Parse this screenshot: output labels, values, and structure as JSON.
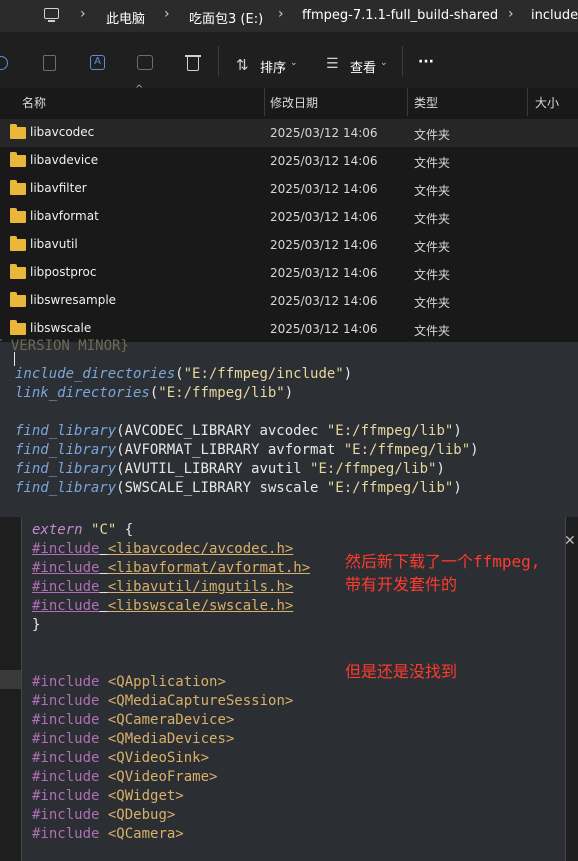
{
  "address_bar": {
    "crumbs": [
      "此电脑",
      "吃面包3 (E:)",
      "ffmpeg-7.1.1-full_build-shared",
      "include"
    ],
    "separator": "›"
  },
  "toolbar": {
    "sort_label": "排序",
    "view_label": "查看",
    "more_label": "···"
  },
  "columns": {
    "name": "名称",
    "modified": "修改日期",
    "type": "类型",
    "size": "大小"
  },
  "files": [
    {
      "name": "libavcodec",
      "date": "2025/03/12 14:06",
      "type": "文件夹"
    },
    {
      "name": "libavdevice",
      "date": "2025/03/12 14:06",
      "type": "文件夹"
    },
    {
      "name": "libavfilter",
      "date": "2025/03/12 14:06",
      "type": "文件夹"
    },
    {
      "name": "libavformat",
      "date": "2025/03/12 14:06",
      "type": "文件夹"
    },
    {
      "name": "libavutil",
      "date": "2025/03/12 14:06",
      "type": "文件夹"
    },
    {
      "name": "libpostproc",
      "date": "2025/03/12 14:06",
      "type": "文件夹"
    },
    {
      "name": "libswresample",
      "date": "2025/03/12 14:06",
      "type": "文件夹"
    },
    {
      "name": "libswscale",
      "date": "2025/03/12 14:06",
      "type": "文件夹"
    }
  ],
  "cmake_snippet": {
    "cut_line": "T VERSION MINOR}",
    "lines": [
      {
        "fn": "include_directories",
        "args": "(",
        "str": "\"E:/ffmpeg/include\"",
        "tail": ")"
      },
      {
        "fn": "link_directories",
        "args": "(",
        "str": "\"E:/ffmpeg/lib\"",
        "tail": ")"
      },
      {
        "fn": "",
        "args": "",
        "str": "",
        "tail": ""
      },
      {
        "fn": "find_library",
        "args": "(AVCODEC_LIBRARY avcodec ",
        "str": "\"E:/ffmpeg/lib\"",
        "tail": ")"
      },
      {
        "fn": "find_library",
        "args": "(AVFORMAT_LIBRARY avformat ",
        "str": "\"E:/ffmpeg/lib\"",
        "tail": ")"
      },
      {
        "fn": "find_library",
        "args": "(AVUTIL_LIBRARY avutil ",
        "str": "\"E:/ffmpeg/lib\"",
        "tail": ")"
      },
      {
        "fn": "find_library",
        "args": "(SWSCALE_LIBRARY swscale ",
        "str": "\"E:/ffmpeg/lib\"",
        "tail": ")"
      }
    ]
  },
  "cpp_snippet": {
    "extern_kw": "extern",
    "extern_str": "\"C\"",
    "extern_open": " {",
    "ffmpeg_includes": [
      "<libavcodec/avcodec.h>",
      "<libavformat/avformat.h>",
      "<libavutil/imgutils.h>",
      "<libswscale/swscale.h>"
    ],
    "close_brace": "}",
    "include_kw": "#include",
    "qt_includes": [
      "<QApplication>",
      "<QMediaCaptureSession>",
      "<QCameraDevice>",
      "<QMediaDevices>",
      "<QVideoSink>",
      "<QVideoFrame>",
      "<QWidget>",
      "<QDebug>",
      "<QCamera>"
    ]
  },
  "annotations": {
    "note1_line1": "然后新下载了一个ffmpeg,",
    "note1_line2": "带有开发套件的",
    "note2": "但是还是没找到"
  }
}
